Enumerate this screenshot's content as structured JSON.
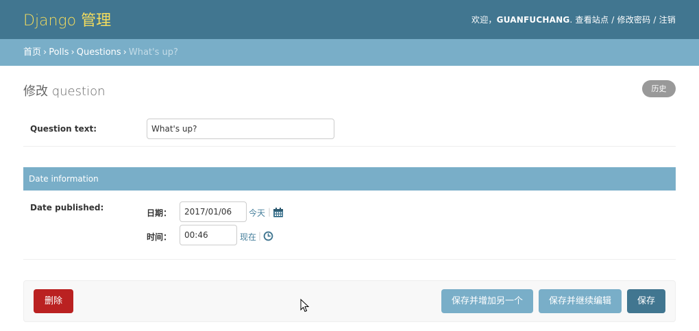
{
  "header": {
    "site_name": "Django 管理",
    "welcome": "欢迎，",
    "username": "GUANFUCHANG",
    "period": ".",
    "view_site": "查看站点",
    "slash1": " / ",
    "change_password": "修改密码",
    "slash2": " / ",
    "logout": "注销"
  },
  "breadcrumbs": {
    "home": "首页",
    "sep": "›",
    "app": "Polls",
    "model": "Questions",
    "current": "What's up?"
  },
  "page": {
    "title": "修改 question",
    "history_label": "历史"
  },
  "form": {
    "question_text_label": "Question text:",
    "question_text_value": "What's up?",
    "fieldset_title": "Date information",
    "date_published_label": "Date published:",
    "date_label": "日期：",
    "date_value": "2017/01/06",
    "today_link": "今天",
    "time_label": "时间：",
    "time_value": "00:46",
    "now_link": "现在",
    "pipe": "|"
  },
  "actions": {
    "delete_label": "删除",
    "save_add_another_label": "保存并增加另一个",
    "save_continue_label": "保存并继续编辑",
    "save_label": "保存"
  },
  "colors": {
    "header_bg": "#417690",
    "brand_text": "#f5dd5d",
    "breadcrumb_bg": "#79aec8",
    "delete_red": "#ba2121",
    "link_blue": "#447e9b"
  },
  "icons": [
    "calendar-icon",
    "clock-icon",
    "mouse-cursor-icon"
  ]
}
